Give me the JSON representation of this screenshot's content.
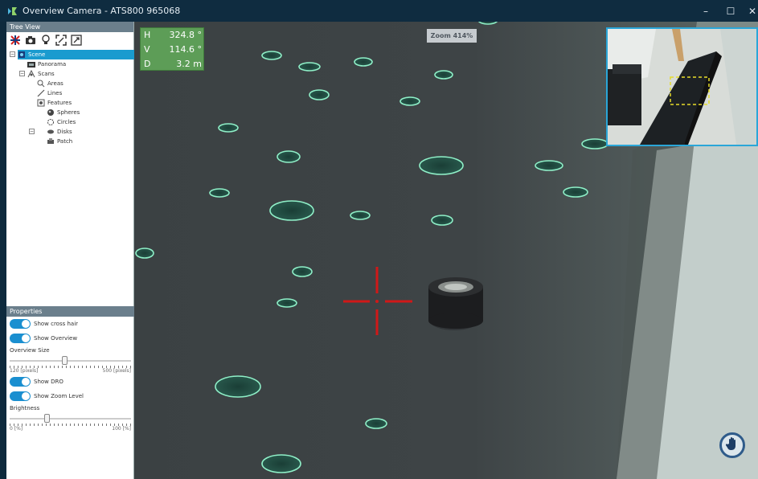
{
  "window": {
    "title": "Overview Camera - ATS800 965068",
    "app_icon": "app-camera-icon",
    "controls": {
      "minimize": "–",
      "maximize": "☐",
      "close": "✕"
    }
  },
  "tree_view": {
    "header": "Tree View",
    "toolbar_icons": [
      "scene-cross-icon",
      "camera-icon",
      "bulb-icon",
      "fit-view-icon",
      "expand-icon"
    ],
    "nodes": [
      {
        "label": "Scene",
        "icon": "scene-icon",
        "selected": true
      },
      {
        "label": "Panorama",
        "icon": "panorama-icon"
      },
      {
        "label": "Scans",
        "icon": "scans-icon"
      },
      {
        "label": "Areas",
        "icon": "areas-icon"
      },
      {
        "label": "Lines",
        "icon": "lines-icon"
      },
      {
        "label": "Features",
        "icon": "features-icon"
      },
      {
        "label": "Spheres",
        "icon": "spheres-icon"
      },
      {
        "label": "Circles",
        "icon": "circles-icon"
      },
      {
        "label": "Disks",
        "icon": "disks-icon"
      },
      {
        "label": "Patch",
        "icon": "patch-icon"
      }
    ]
  },
  "properties": {
    "header": "Properties",
    "show_cross_hair": "Show cross hair",
    "show_overview": "Show Overview",
    "overview_size": {
      "label": "Overview Size",
      "min": "120 [pixels]",
      "max": "500 [pixels]",
      "value_fraction": 0.45
    },
    "show_dro": "Show DRO",
    "show_zoom_level": "Show Zoom Level",
    "brightness": {
      "label": "Brightness",
      "min": "0 [%]",
      "max": "100 [%]",
      "value_fraction": 0.3
    }
  },
  "dro": {
    "h_label": "H",
    "h_value": "324.8 °",
    "v_label": "V",
    "v_value": "114.6 °",
    "d_label": "D",
    "d_value": "3.2 m"
  },
  "zoom_label": "Zoom 414%",
  "colors": {
    "accent": "#1a9bcf",
    "dro_bg": "#5d9d57",
    "crosshair": "#d01818",
    "target_outline": "#8ff0c8"
  }
}
